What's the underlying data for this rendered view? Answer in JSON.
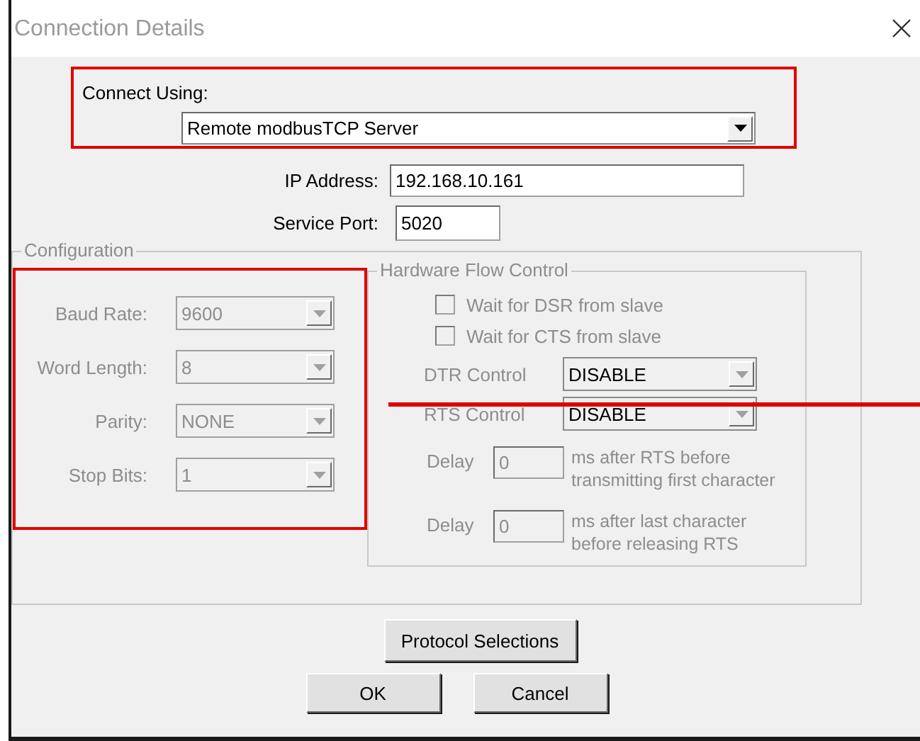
{
  "window": {
    "title": "Connection Details"
  },
  "connect_using": {
    "label": "Connect Using:",
    "value": "Remote modbusTCP Server",
    "highlighted": true
  },
  "network": [
    {
      "label": "IP Address:",
      "value": "192.168.10.161"
    },
    {
      "label": "Service Port:",
      "value": "5020"
    }
  ],
  "configuration": {
    "title": "Configuration",
    "serial": {
      "highlighted": true,
      "fields": [
        {
          "label": "Baud Rate:",
          "value": "9600",
          "disabled": true
        },
        {
          "label": "Word Length:",
          "value": "8",
          "disabled": true
        },
        {
          "label": "Parity:",
          "value": "NONE",
          "disabled": true
        },
        {
          "label": "Stop Bits:",
          "value": "1",
          "disabled": true
        }
      ]
    },
    "hardware_flow_control": {
      "title": "Hardware Flow Control",
      "checkboxes": [
        {
          "label": "Wait for DSR from slave",
          "checked": false,
          "disabled": true
        },
        {
          "label": "Wait for CTS from slave",
          "checked": false,
          "disabled": true
        }
      ],
      "controls": [
        {
          "label": "DTR Control",
          "value": "DISABLE",
          "disabled": true
        },
        {
          "label": "RTS Control",
          "value": "DISABLE",
          "disabled": true
        }
      ],
      "delays": [
        {
          "label": "Delay",
          "value": "0",
          "description": "ms after RTS before transmitting first character",
          "disabled": true
        },
        {
          "label": "Delay",
          "value": "0",
          "description": "ms after last character before releasing RTS",
          "disabled": true
        }
      ]
    }
  },
  "protocol_button": {
    "label": "Protocol Selections"
  },
  "buttons": [
    {
      "label": "OK"
    },
    {
      "label": "Cancel"
    }
  ]
}
